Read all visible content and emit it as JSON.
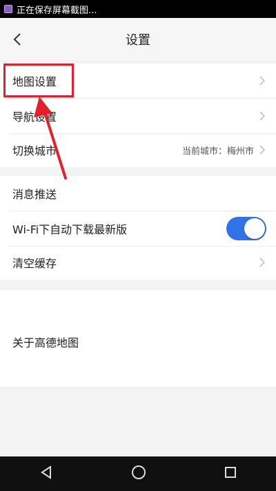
{
  "status_bar": {
    "text": "正在保存屏幕截图..."
  },
  "header": {
    "title": "设置"
  },
  "group1": [
    {
      "label": "地图设置"
    },
    {
      "label": "导航设置"
    },
    {
      "label": "切换城市",
      "value": "当前城市：梅州市"
    }
  ],
  "group2": [
    {
      "label": "消息推送"
    },
    {
      "label": "Wi-Fi下自动下载最新版",
      "toggle_on": true
    },
    {
      "label": "清空缓存"
    }
  ],
  "group3": [
    {
      "label": "关于高德地图"
    }
  ],
  "colors": {
    "accent": "#2f73e6",
    "highlight": "#e3202a"
  },
  "icons": [
    "back-icon",
    "chevron-right-icon",
    "nav-back-icon",
    "nav-home-icon",
    "nav-recents-icon"
  ]
}
